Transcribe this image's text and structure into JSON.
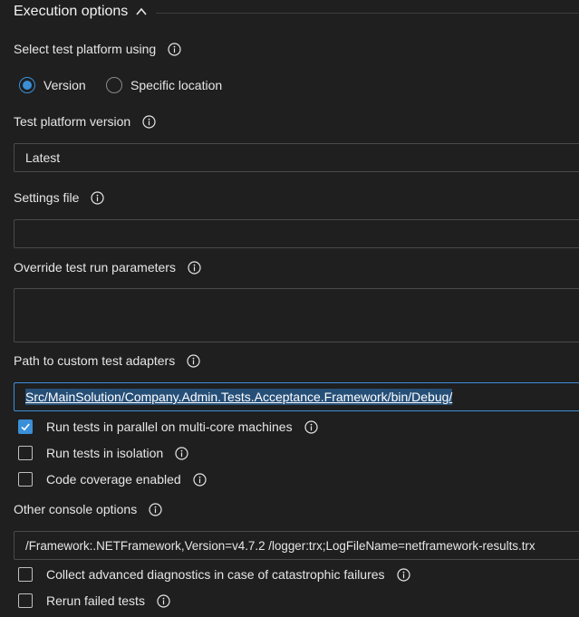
{
  "section": {
    "title": "Execution options"
  },
  "platform": {
    "label": "Select test platform using",
    "options": [
      {
        "label": "Version",
        "selected": true
      },
      {
        "label": "Specific location",
        "selected": false
      }
    ]
  },
  "platform_version": {
    "label": "Test platform version",
    "value": "Latest"
  },
  "settings_file": {
    "label": "Settings file",
    "value": ""
  },
  "override_params": {
    "label": "Override test run parameters",
    "value": ""
  },
  "adapters": {
    "label": "Path to custom test adapters",
    "value": "Src/MainSolution/Company.Admin.Tests.Acceptance.Framework/bin/Debug/"
  },
  "checks": [
    {
      "label": "Run tests in parallel on multi-core machines",
      "checked": true
    },
    {
      "label": "Run tests in isolation",
      "checked": false
    },
    {
      "label": "Code coverage enabled",
      "checked": false
    }
  ],
  "console": {
    "label": "Other console options",
    "value": "/Framework:.NETFramework,Version=v4.7.2 /logger:trx;LogFileName=netframework-results.trx"
  },
  "bottom_checks": [
    {
      "label": "Collect advanced diagnostics in case of catastrophic failures",
      "checked": false
    },
    {
      "label": "Rerun failed tests",
      "checked": false
    }
  ],
  "colors": {
    "accent": "#3b8fd9",
    "background": "#1f1f1f",
    "border": "#4a4a4a",
    "selection": "#264f78"
  }
}
